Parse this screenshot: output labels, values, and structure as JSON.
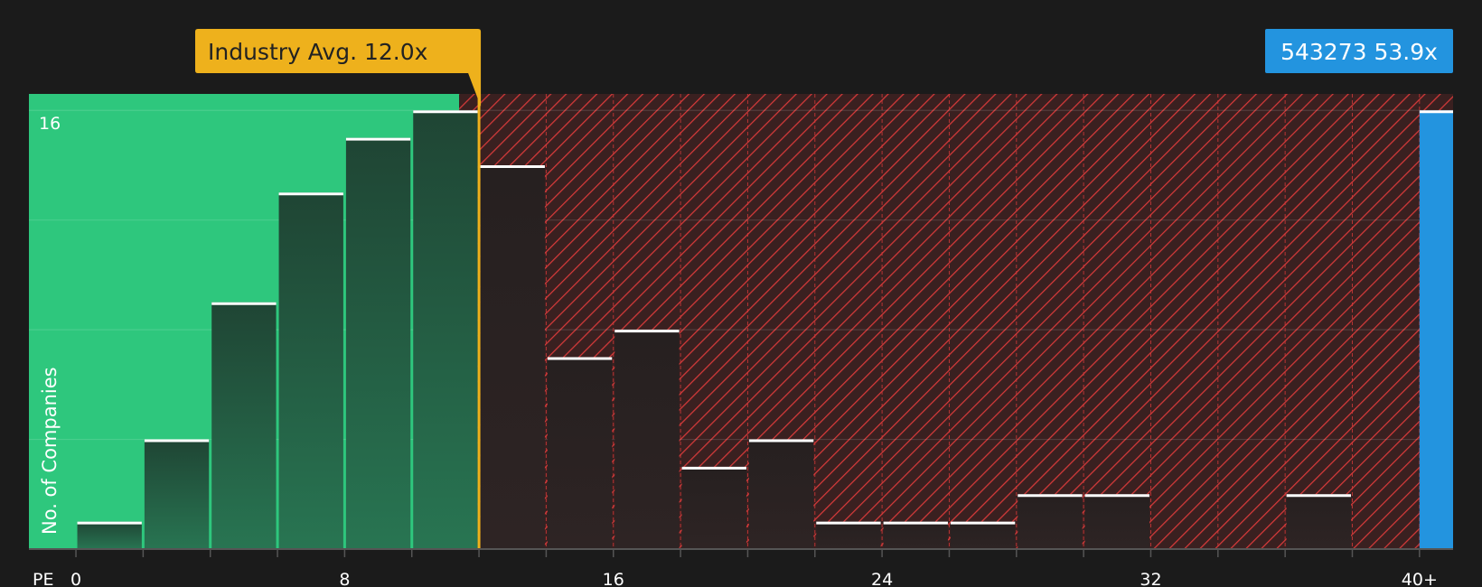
{
  "chart_data": {
    "type": "bar",
    "title": "",
    "xlabel": "PE",
    "ylabel": "No. of Companies",
    "x_ticks": [
      "0",
      "8",
      "16",
      "24",
      "32",
      "40+"
    ],
    "x_tick_values": [
      0,
      8,
      16,
      24,
      32,
      40
    ],
    "y_tick_labels": [
      "16"
    ],
    "y_tick_values": [
      16
    ],
    "xlim": [
      -1.4,
      41
    ],
    "ylim": [
      0,
      16.6
    ],
    "bins": [
      {
        "x0": 0,
        "x1": 2,
        "count": 1
      },
      {
        "x0": 2,
        "x1": 4,
        "count": 4
      },
      {
        "x0": 4,
        "x1": 6,
        "count": 9
      },
      {
        "x0": 6,
        "x1": 8,
        "count": 13
      },
      {
        "x0": 8,
        "x1": 10,
        "count": 15
      },
      {
        "x0": 10,
        "x1": 12,
        "count": 16
      },
      {
        "x0": 12,
        "x1": 14,
        "count": 14
      },
      {
        "x0": 14,
        "x1": 16,
        "count": 7
      },
      {
        "x0": 16,
        "x1": 18,
        "count": 8
      },
      {
        "x0": 18,
        "x1": 20,
        "count": 3
      },
      {
        "x0": 20,
        "x1": 22,
        "count": 4
      },
      {
        "x0": 22,
        "x1": 24,
        "count": 1
      },
      {
        "x0": 24,
        "x1": 26,
        "count": 1
      },
      {
        "x0": 26,
        "x1": 28,
        "count": 1
      },
      {
        "x0": 28,
        "x1": 30,
        "count": 2
      },
      {
        "x0": 30,
        "x1": 32,
        "count": 2
      },
      {
        "x0": 36,
        "x1": 38,
        "count": 2
      }
    ],
    "industry_avg": {
      "value": 12.0,
      "label": "Industry Avg. 12.0x"
    },
    "company": {
      "name": "543273",
      "value": 53.9,
      "label": "543273 53.9x",
      "count": 16
    },
    "colors": {
      "background": "#1b1b1b",
      "undervalued_zone": "#2ec77d",
      "overvalued_zone": "#3a2020",
      "hatch": "#d63a3a",
      "industry_avg": "#eeb11c",
      "company": "#2394df",
      "bar_cap": "#ffffff"
    },
    "grid": true
  }
}
